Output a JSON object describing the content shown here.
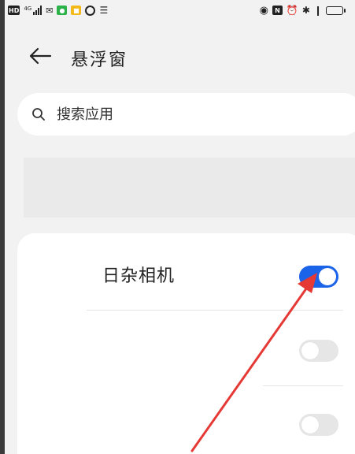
{
  "status_bar": {
    "left_icons": [
      "hd-icon",
      "signal-icon",
      "sim-icon",
      "wechat-icon",
      "yellow-app-icon",
      "ring-icon",
      "recorder-icon"
    ],
    "right_icons": [
      "eye-icon",
      "nfc-icon",
      "alarm-icon",
      "bluetooth-icon",
      "vibrate-icon",
      "battery-icon"
    ],
    "hd_text": "HD",
    "signal_prefix": "4G"
  },
  "header": {
    "title": "悬浮窗"
  },
  "search": {
    "placeholder": "搜索应用"
  },
  "apps": [
    {
      "name": "日杂相机",
      "enabled": true
    },
    {
      "name": "",
      "enabled": false
    },
    {
      "name": "",
      "enabled": false
    }
  ],
  "colors": {
    "background": "#f2f2f2",
    "toggle_on": "#1b63e8",
    "toggle_off": "#e6e6e6",
    "annotation_arrow": "#e53935"
  }
}
